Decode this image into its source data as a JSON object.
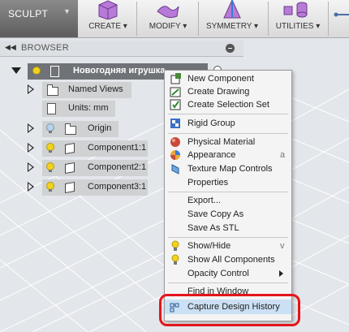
{
  "toolbar": {
    "sculpt_label": "SCULPT",
    "groups": [
      "CREATE",
      "MODIFY",
      "SYMMETRY",
      "UTILITIES"
    ]
  },
  "browser": {
    "header": "BROWSER",
    "root": "Новогодняя игрушка...",
    "items": [
      "Named Views",
      "Units: mm",
      "Origin",
      "Component1:1",
      "Component2:1",
      "Component3:1"
    ]
  },
  "menu": {
    "new_component": "New Component",
    "create_drawing": "Create Drawing",
    "create_selection_set": "Create Selection Set",
    "rigid_group": "Rigid Group",
    "physical_material": "Physical Material",
    "appearance": "Appearance",
    "appearance_shortcut": "a",
    "texture_map_controls": "Texture Map Controls",
    "properties": "Properties",
    "export": "Export...",
    "save_copy_as": "Save Copy As",
    "save_as_stl": "Save As STL",
    "show_hide": "Show/Hide",
    "show_hide_shortcut": "v",
    "show_all_components": "Show All Components",
    "opacity_control": "Opacity Control",
    "find_in_window": "Find in Window",
    "capture_design_history": "Capture Design History"
  },
  "colors": {
    "highlight": "#cbe0f4",
    "annotation": "#e4141b"
  }
}
